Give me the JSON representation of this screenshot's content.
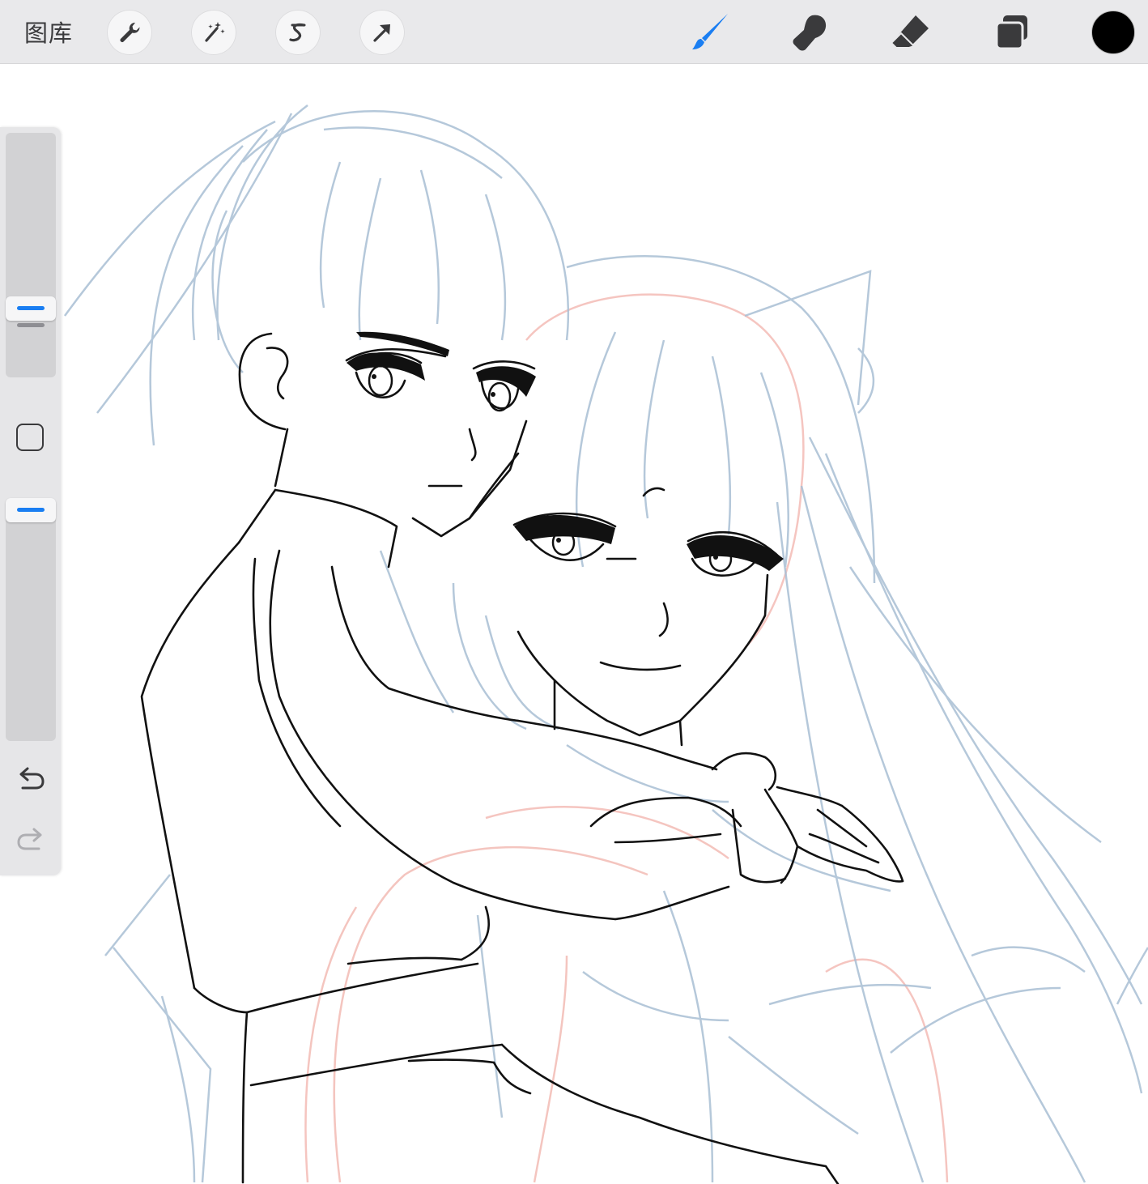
{
  "toolbar": {
    "gallery_label": "图库",
    "left_tools": [
      {
        "name": "actions",
        "icon": "wrench-icon"
      },
      {
        "name": "adjustments",
        "icon": "magic-wand-icon"
      },
      {
        "name": "selection",
        "icon": "selection-s-icon"
      },
      {
        "name": "transform",
        "icon": "arrow-cursor-icon"
      }
    ],
    "right_tools": [
      {
        "name": "brush",
        "icon": "brush-icon",
        "active": true
      },
      {
        "name": "smudge",
        "icon": "smudge-finger-icon",
        "active": false
      },
      {
        "name": "eraser",
        "icon": "eraser-icon",
        "active": false
      },
      {
        "name": "layers",
        "icon": "layers-icon",
        "active": false
      }
    ],
    "current_color": "#000000",
    "active_color": "#1a7ef2"
  },
  "sidebar": {
    "brush_size_handle": "brush-size-slider",
    "opacity_handle": "opacity-slider",
    "modify_button": "square-icon",
    "undo": "undo-icon",
    "redo": "redo-icon"
  },
  "canvas": {
    "content": "line-art-sketch",
    "sketch_color": "#a9bfd4",
    "ink_color": "#111111",
    "guide_color": "#f2b7b0"
  }
}
